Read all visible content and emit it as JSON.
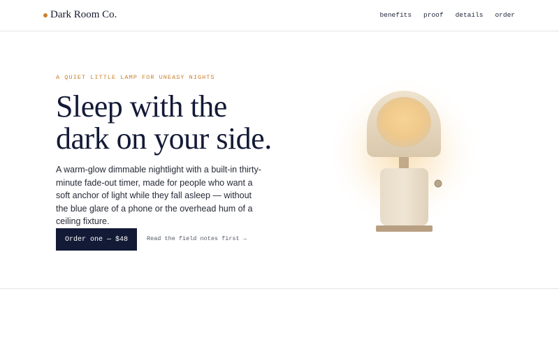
{
  "header": {
    "brand_name": "Dark Room Co.",
    "nav": [
      {
        "label": "benefits"
      },
      {
        "label": "proof"
      },
      {
        "label": "details"
      },
      {
        "label": "order"
      }
    ]
  },
  "hero": {
    "eyebrow": "A QUIET LITTLE LAMP FOR UNEASY NIGHTS",
    "headline_line1": "Sleep with the",
    "headline_line2": "dark on your side.",
    "body": "A warm-glow dimmable nightlight with a built-in thirty-minute fade-out timer, made for people who want a soft anchor of light while they fall asleep — without the blue glare of a phone or the overhead hum of a ceiling fixture.",
    "cta_label": "Order one — $48",
    "secondary_link": "Read the field notes first →"
  },
  "colors": {
    "accent": "#c9802d",
    "ink": "#131a36",
    "button_bg": "#131a36"
  },
  "icons": {
    "brand_mark": "dot-icon",
    "product": "nightlight-lamp-illustration"
  }
}
